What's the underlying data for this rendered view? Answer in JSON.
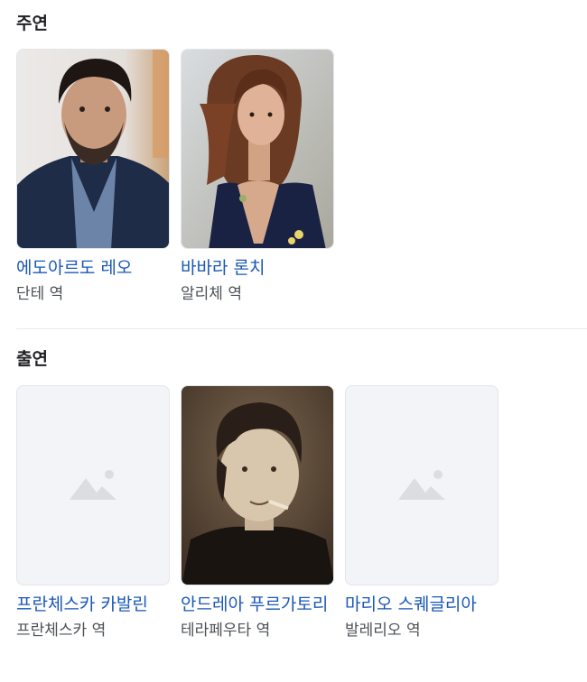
{
  "sections": [
    {
      "title": "주연",
      "cast": [
        {
          "name": "에도아르도 레오",
          "role": "단테 역",
          "photo": "photo"
        },
        {
          "name": "바바라 론치",
          "role": "알리체 역",
          "photo": "photo"
        }
      ]
    },
    {
      "title": "출연",
      "cast": [
        {
          "name": "프란체스카 카발린",
          "role": "프란체스카 역",
          "photo": "image-placeholder-icon"
        },
        {
          "name": "안드레아 푸르가토리",
          "role": "테라페우타 역",
          "photo": "photo"
        },
        {
          "name": "마리오 스퀘글리아",
          "role": "발레리오 역",
          "photo": "image-placeholder-icon"
        }
      ]
    }
  ],
  "colors": {
    "link": "#1a57b8",
    "secondary_text": "#4d5156",
    "placeholder_bg": "#f3f4f7",
    "placeholder_icon": "#dcdde1"
  }
}
